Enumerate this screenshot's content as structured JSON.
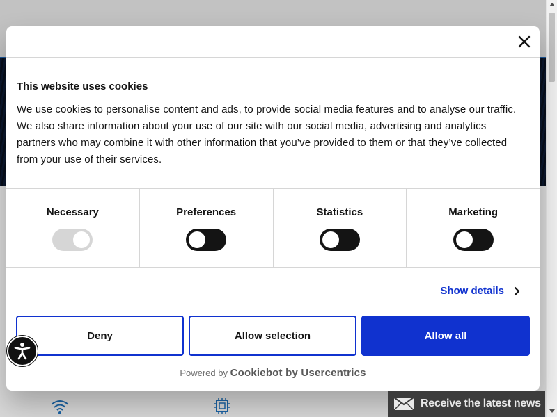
{
  "dialog": {
    "title": "This website uses cookies",
    "body": "We use cookies to personalise content and ads, to provide social media features and to analyse our traffic. We also share information about your use of our site with our social media, advertising and analytics partners who may combine it with other information that you’ve provided to them or that they’ve collected from your use of their services.",
    "close_icon": "close-icon",
    "categories": [
      {
        "label": "Necessary",
        "enabled": true,
        "locked": true
      },
      {
        "label": "Preferences",
        "enabled": false,
        "locked": false
      },
      {
        "label": "Statistics",
        "enabled": false,
        "locked": false
      },
      {
        "label": "Marketing",
        "enabled": false,
        "locked": false
      }
    ],
    "show_details": "Show details",
    "buttons": {
      "deny": "Deny",
      "allow_selection": "Allow selection",
      "allow_all": "Allow all"
    },
    "powered_prefix": "Powered by",
    "powered_brand": "Cookiebot by Usercentrics"
  },
  "newsletter": {
    "label": "Receive the latest news",
    "icon": "mail-icon"
  },
  "accessibility": {
    "icon": "accessibility-icon"
  },
  "colors": {
    "accent": "#1032cf",
    "toggle_off": "#141414",
    "toggle_locked": "#d6d6d6",
    "newsletter_bg": "#3c3c3c"
  }
}
